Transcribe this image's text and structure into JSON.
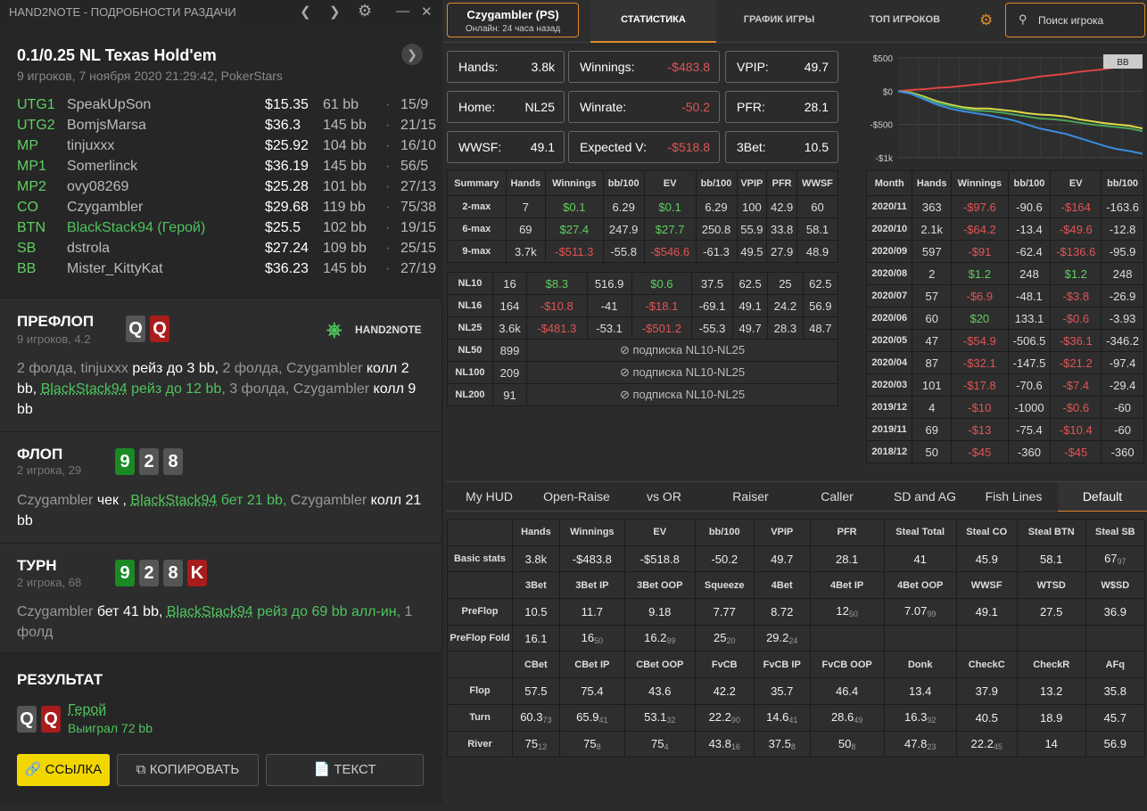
{
  "window": {
    "title": "HAND2NOTE - ПОДРОБНОСТИ РАЗДАЧИ"
  },
  "hand": {
    "title": "0.1/0.25 NL Texas Hold'em",
    "subtitle": "9 игроков, 7 ноября 2020 21:29:42, PokerStars",
    "players": [
      {
        "pos": "UTG1",
        "name": "SpeakUpSon",
        "stack": "$15.35",
        "bb": "61 bb",
        "stat": "15/9"
      },
      {
        "pos": "UTG2",
        "name": "BomjsMarsa",
        "stack": "$36.3",
        "bb": "145 bb",
        "stat": "21/15"
      },
      {
        "pos": "MP",
        "name": "tinjuxxx",
        "stack": "$25.92",
        "bb": "104 bb",
        "stat": "16/10"
      },
      {
        "pos": "MP1",
        "name": "Somerlinck",
        "stack": "$36.19",
        "bb": "145 bb",
        "stat": "56/5"
      },
      {
        "pos": "MP2",
        "name": "ovy08269",
        "stack": "$25.28",
        "bb": "101 bb",
        "stat": "27/13"
      },
      {
        "pos": "CO",
        "name": "Czygambler",
        "stack": "$29.68",
        "bb": "119 bb",
        "stat": "75/38"
      },
      {
        "pos": "BTN",
        "name": "BlackStack94 (Герой)",
        "stack": "$25.5",
        "bb": "102 bb",
        "stat": "19/15"
      },
      {
        "pos": "SB",
        "name": "dstrola",
        "stack": "$27.24",
        "bb": "109 bb",
        "stat": "25/15"
      },
      {
        "pos": "BB",
        "name": "Mister_KittyKat",
        "stack": "$36.23",
        "bb": "145 bb",
        "stat": "27/19"
      }
    ]
  },
  "preflop": {
    "title": "ПРЕФЛОП",
    "sub": "9 игроков, 4.2",
    "cards": [
      "Q",
      "Q"
    ],
    "a1": "2 фолда, tinjuxxx ",
    "a2": "рейз до 3 bb,",
    "a3": " 2 фолда, Czygambler ",
    "a4": "колл 2 bb,",
    "a5": "BlackStack94",
    "a6": " рейз до 12 bb,",
    "a7": " 3 фолда, Czygambler ",
    "a8": "колл 9 bb"
  },
  "logo": {
    "l2": "HAND2NOTE"
  },
  "flop": {
    "title": "ФЛОП",
    "sub": "2 игрока, 29",
    "cards": [
      "9",
      "2",
      "8"
    ],
    "a1": "Czygambler ",
    "a2": "чек ,",
    "a3": "BlackStack94",
    "a4": " бет 21 bb,",
    "a5": " Czygambler ",
    "a6": "колл 21 bb"
  },
  "turn": {
    "title": "ТУРН",
    "sub": "2 игрока, 68",
    "cards": [
      "9",
      "2",
      "8",
      "K"
    ],
    "a1": "Czygambler ",
    "a2": "бет 41 bb,",
    "a3": "BlackStack94",
    "a4": " рейз до 69 bb алл-ин,",
    "a5": " 1 фолд"
  },
  "result": {
    "title": "РЕЗУЛЬТАТ",
    "cards": [
      "Q",
      "Q"
    ],
    "hero": "Герой",
    "won": "Выиграл 72 bb"
  },
  "buttons": {
    "link": "ССЫЛКА",
    "copy": "КОПИРОВАТЬ",
    "text": "ТЕКСТ"
  },
  "player": {
    "name": "Czygambler (PS)",
    "online": "Онлайн: 24 часа назад"
  },
  "tabs": [
    "СТАТИСТИКА",
    "ГРАФИК ИГРЫ",
    "ТОП ИГРОКОВ"
  ],
  "search": {
    "placeholder": "Поиск игрока"
  },
  "kv": [
    {
      "k": "Hands:",
      "v": "3.8k"
    },
    {
      "k": "Winnings:",
      "v": "-$483.8"
    },
    {
      "k": "VPIP:",
      "v": "49.7"
    },
    {
      "k": "Home:",
      "v": "NL25"
    },
    {
      "k": "Winrate:",
      "v": "-50.2"
    },
    {
      "k": "PFR:",
      "v": "28.1"
    },
    {
      "k": "WWSF:",
      "v": "49.1"
    },
    {
      "k": "Expected V:",
      "v": "-$518.8"
    },
    {
      "k": "3Bet:",
      "v": "10.5"
    }
  ],
  "summary": {
    "headers": [
      "Summary",
      "Hands",
      "Winnings",
      "bb/100",
      "EV",
      "bb/100",
      "VPIP",
      "PFR",
      "WWSF"
    ],
    "rows": [
      [
        "2-max",
        "7",
        "$0.1",
        "6.29",
        "$0.1",
        "6.29",
        "100",
        "42.9",
        "60"
      ],
      [
        "6-max",
        "69",
        "$27.4",
        "247.9",
        "$27.7",
        "250.8",
        "55.9",
        "33.8",
        "58.1"
      ],
      [
        "9-max",
        "3.7k",
        "-$511.3",
        "-55.8",
        "-$546.6",
        "-61.3",
        "49.5",
        "27.9",
        "48.9"
      ]
    ]
  },
  "nl": {
    "rows": [
      [
        "NL10",
        "16",
        "$8.3",
        "516.9",
        "$0.6",
        "37.5",
        "62.5",
        "25",
        "62.5"
      ],
      [
        "NL16",
        "164",
        "-$10.8",
        "-41",
        "-$18.1",
        "-69.1",
        "49.1",
        "24.2",
        "56.9"
      ],
      [
        "NL25",
        "3.6k",
        "-$481.3",
        "-53.1",
        "-$501.2",
        "-55.3",
        "49.7",
        "28.3",
        "48.7"
      ]
    ],
    "locked": [
      [
        "NL50",
        "899"
      ],
      [
        "NL100",
        "209"
      ],
      [
        "NL200",
        "91"
      ]
    ],
    "lock_text": "подписка NL10-NL25"
  },
  "months": {
    "headers": [
      "Month",
      "Hands",
      "Winnings",
      "bb/100",
      "EV",
      "bb/100"
    ],
    "rows": [
      [
        "2020/11",
        "363",
        "-$97.6",
        "-90.6",
        "-$164",
        "-163.6"
      ],
      [
        "2020/10",
        "2.1k",
        "-$64.2",
        "-13.4",
        "-$49.6",
        "-12.8"
      ],
      [
        "2020/09",
        "597",
        "-$91",
        "-62.4",
        "-$136.6",
        "-95.9"
      ],
      [
        "2020/08",
        "2",
        "$1.2",
        "248",
        "$1.2",
        "248"
      ],
      [
        "2020/07",
        "57",
        "-$6.9",
        "-48.1",
        "-$3.8",
        "-26.9"
      ],
      [
        "2020/06",
        "60",
        "$20",
        "133.1",
        "-$0.6",
        "-3.93"
      ],
      [
        "2020/05",
        "47",
        "-$54.9",
        "-506.5",
        "-$36.1",
        "-346.2"
      ],
      [
        "2020/04",
        "87",
        "-$32.1",
        "-147.5",
        "-$21.2",
        "-97.4"
      ],
      [
        "2020/03",
        "101",
        "-$17.8",
        "-70.6",
        "-$7.4",
        "-29.4"
      ],
      [
        "2019/12",
        "4",
        "-$10",
        "-1000",
        "-$0.6",
        "-60"
      ],
      [
        "2019/11",
        "69",
        "-$13",
        "-75.4",
        "-$10.4",
        "-60"
      ],
      [
        "2018/12",
        "50",
        "-$45",
        "-360",
        "-$45",
        "-360"
      ]
    ]
  },
  "chart_data": {
    "type": "line",
    "yticks": [
      "$500",
      "$0",
      "-$500",
      "-$1k"
    ],
    "badge": "BB",
    "series": [
      {
        "color": "#e04444",
        "values": [
          0,
          20,
          30,
          50,
          60,
          80,
          100,
          120,
          140,
          160,
          190,
          220,
          240,
          260,
          290,
          310,
          330,
          360,
          380,
          410
        ]
      },
      {
        "color": "#ddd94a",
        "values": [
          0,
          -20,
          -80,
          -150,
          -200,
          -240,
          -260,
          -260,
          -280,
          -300,
          -330,
          -350,
          -360,
          -380,
          -420,
          -450,
          -480,
          -500,
          -520,
          -560
        ]
      },
      {
        "color": "#4aa65a",
        "values": [
          0,
          -30,
          -100,
          -170,
          -220,
          -260,
          -290,
          -300,
          -320,
          -350,
          -380,
          -410,
          -420,
          -440,
          -470,
          -500,
          -520,
          -540,
          -560,
          -600
        ]
      },
      {
        "color": "#3a8de0",
        "values": [
          0,
          -40,
          -120,
          -200,
          -260,
          -300,
          -330,
          -360,
          -400,
          -440,
          -500,
          -560,
          -600,
          -640,
          -700,
          -760,
          -820,
          -870,
          -900,
          -940
        ]
      }
    ]
  },
  "hudtabs": [
    "My HUD",
    "Open-Raise",
    "vs OR",
    "Raiser",
    "Caller",
    "SD and AG",
    "Fish Lines",
    "Default"
  ],
  "hud": [
    {
      "type": "h",
      "cells": [
        "",
        "Hands",
        "Winnings",
        "EV",
        "bb/100",
        "VPIP",
        "PFR",
        "Steal Total",
        "Steal CO",
        "Steal BTN",
        "Steal SB"
      ]
    },
    {
      "type": "d",
      "cells": [
        "Basic stats",
        "3.8k",
        "-$483.8",
        "-$518.8",
        "-50.2",
        "49.7",
        "28.1",
        "41",
        "45.9",
        "58.1",
        "67|97"
      ]
    },
    {
      "type": "h",
      "cells": [
        "",
        "3Bet",
        "3Bet IP",
        "3Bet OOP",
        "Squeeze",
        "4Bet",
        "4Bet IP",
        "4Bet OOP",
        "WWSF",
        "WTSD",
        "W$SD"
      ]
    },
    {
      "type": "d",
      "cells": [
        "PreFlop",
        "10.5",
        "11.7",
        "9.18",
        "7.77",
        "8.72",
        "12|50",
        "7.07|99",
        "49.1",
        "27.5",
        "36.9"
      ]
    },
    {
      "type": "d",
      "cells": [
        "PreFlop Fold",
        "16.1",
        "16|50",
        "16.2|99",
        "25|20",
        "29.2|24",
        "",
        "",
        "",
        "",
        ""
      ]
    },
    {
      "type": "h",
      "cells": [
        "",
        "CBet",
        "CBet IP",
        "CBet OOP",
        "FvCB",
        "FvCB IP",
        "FvCB OOP",
        "Donk",
        "CheckC",
        "CheckR",
        "AFq"
      ]
    },
    {
      "type": "d",
      "cells": [
        "Flop",
        "57.5",
        "75.4",
        "43.6",
        "42.2",
        "35.7",
        "46.4",
        "13.4",
        "37.9",
        "13.2",
        "35.8"
      ]
    },
    {
      "type": "d",
      "cells": [
        "Turn",
        "60.3|73",
        "65.9|41",
        "53.1|32",
        "22.2|90",
        "14.6|41",
        "28.6|49",
        "16.3|92",
        "40.5",
        "18.9",
        "45.7"
      ]
    },
    {
      "type": "d",
      "cells": [
        "River",
        "75|12",
        "75|8",
        "75|4",
        "43.8|16",
        "37.5|8",
        "50|8",
        "47.8|23",
        "22.2|45",
        "14",
        "56.9"
      ]
    }
  ]
}
